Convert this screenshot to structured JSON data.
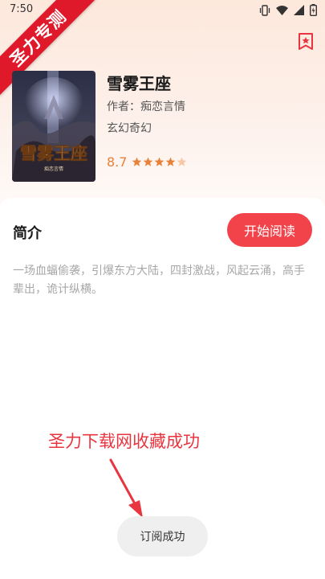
{
  "status_bar": {
    "time": "7:50"
  },
  "watermark": {
    "ribbon_text": "圣力专测"
  },
  "book": {
    "title": "雪雾王座",
    "author": "作者：痴恋言情",
    "genre": "玄幻奇幻",
    "rating": "8.7",
    "stars_filled": 4,
    "stars_total": 5,
    "cover_title": "雪雾王座",
    "cover_author": "痴恋言情"
  },
  "intro": {
    "title": "简介",
    "text": "一场血蝠偷袭，引爆东方大陆，四封激战，风起云涌，高手辈出，诡计纵横。"
  },
  "actions": {
    "start_reading": "开始阅读"
  },
  "annotation": {
    "text": "圣力下载网收藏成功"
  },
  "toast": {
    "text": "订阅成功"
  },
  "colors": {
    "accent": "#f2434a",
    "rating": "#e8813a",
    "ribbon": "#e0192a",
    "annotation": "#e8353f"
  },
  "icons": {
    "bookmark": "bookmark-star-icon",
    "star": "star-icon",
    "vibrate": "vibrate-icon",
    "wifi": "wifi-icon",
    "battery": "battery-icon"
  }
}
